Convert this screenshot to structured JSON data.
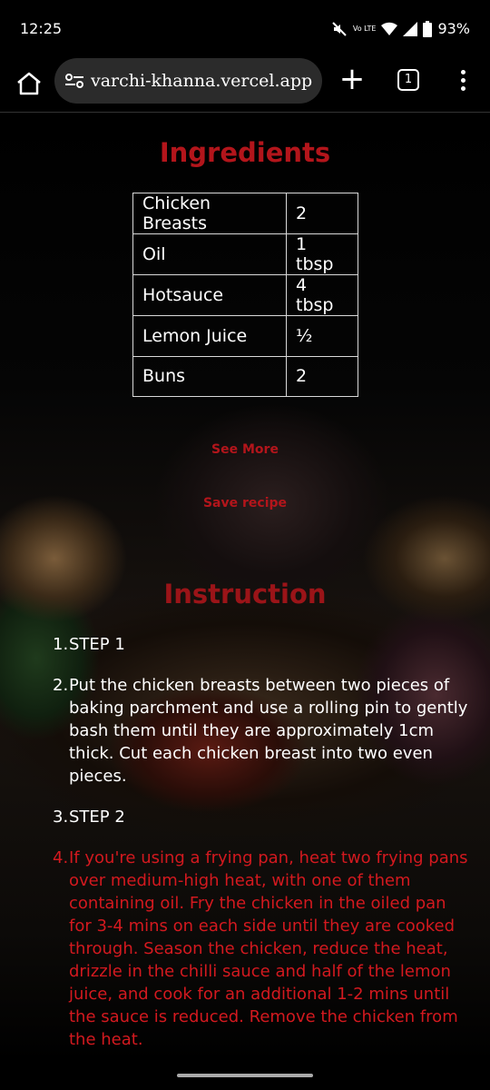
{
  "status_bar": {
    "time": "12:25",
    "lte_label": "Vo LTE",
    "battery": "93%"
  },
  "browser": {
    "url": "varchi-khanna.vercel.app",
    "tab_count": "1"
  },
  "ingredients": {
    "title": "Ingredients",
    "rows": [
      {
        "name": "Chicken Breasts",
        "qty": "2"
      },
      {
        "name": "Oil",
        "qty": "1 tbsp"
      },
      {
        "name": "Hotsauce",
        "qty": "4 tbsp"
      },
      {
        "name": "Lemon Juice",
        "qty": "½"
      },
      {
        "name": "Buns",
        "qty": "2"
      }
    ]
  },
  "links": {
    "see_more": "See More",
    "save_recipe": "Save recipe"
  },
  "instruction": {
    "title": "Instruction",
    "steps": [
      {
        "num": "1.",
        "text": "STEP 1"
      },
      {
        "num": "2.",
        "text": "Put the chicken breasts between two pieces of baking parchment and use a rolling pin to gently bash them until they are approximately 1cm thick. Cut each chicken breast into two even pieces."
      },
      {
        "num": "3.",
        "text": "STEP 2"
      },
      {
        "num": "4.",
        "text": "If you're using a frying pan, heat two frying pans over medium-high heat, with one of them containing oil. Fry the chicken in the oiled pan for 3-4 mins on each side until they are cooked through. Season the chicken, reduce the heat, drizzle in the chilli sauce and half of the lemon juice, and cook for an additional 1-2 mins until the sauce is reduced. Remove the chicken from the heat."
      }
    ]
  },
  "colors": {
    "accent": "#b3151b",
    "step_highlight": "#d3191f"
  }
}
